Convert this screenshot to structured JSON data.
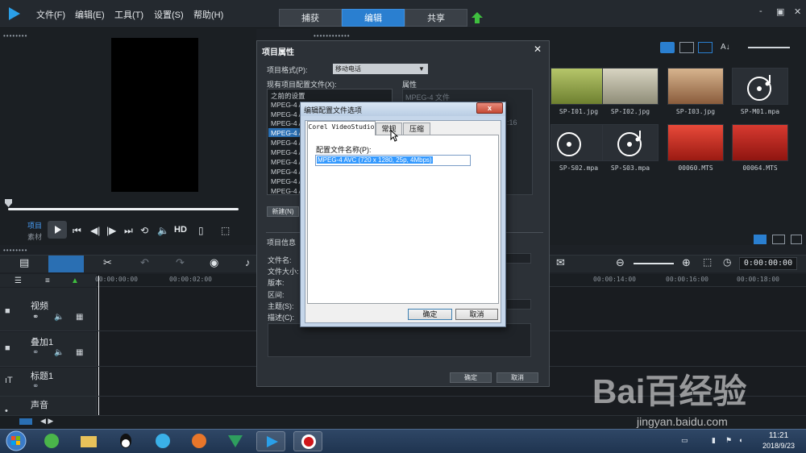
{
  "menu": {
    "file": "文件(F)",
    "edit": "编辑(E)",
    "tools": "工具(T)",
    "settings": "设置(S)",
    "help": "帮助(H)"
  },
  "mode_tabs": {
    "capture": "捕获",
    "edit": "编辑",
    "share": "共享"
  },
  "window_controls": {
    "minimize": "-",
    "restore": "▣",
    "close": "✕"
  },
  "preview": {
    "mode_project": "项目",
    "mode_clip": "素材",
    "hd": "HD"
  },
  "library": {
    "thumbnails": [
      {
        "label": "SP-I01.jpg"
      },
      {
        "label": "SP-I02.jpg"
      },
      {
        "label": "SP-I03.jpg"
      },
      {
        "label": "SP-M01.mpa"
      },
      {
        "label": "SP-S02.mpa"
      },
      {
        "label": "SP-S03.mpa"
      },
      {
        "label": "00060.MTS"
      },
      {
        "label": "00064.MTS"
      }
    ]
  },
  "timeline": {
    "timecode": "0:00:00:00",
    "ruler": [
      "00:00:00:00",
      "00:00:02:00",
      "00:00:14:00",
      "00:00:16:00",
      "00:00:18:00"
    ],
    "tracks": [
      {
        "name": "视频"
      },
      {
        "name": "叠加1"
      },
      {
        "name": "标题1"
      },
      {
        "name": "声音"
      }
    ]
  },
  "project_props": {
    "title": "项目属性",
    "format_label": "项目格式(P):",
    "format_value": "移动电话",
    "profiles_label": "现有项目配置文件(X):",
    "properties_label": "属性",
    "properties_value": "MPEG-4 文件",
    "properties_partial": ":16",
    "profiles": [
      "之前的设置",
      "MPEG-4 A",
      "MPEG-4 A",
      "MPEG-4 A",
      "MPEG-4 A",
      "MPEG-4 A",
      "MPEG-4 A",
      "MPEG-4 A",
      "MPEG-4 A",
      "MPEG-4 A",
      "MPEG-4 A"
    ],
    "new_button": "新建(N)",
    "info_label": "项目信息",
    "filename_label": "文件名:",
    "filesize_label": "文件大小:",
    "version_label": "版本:",
    "duration_label": "区间:",
    "subject_label": "主题(S):",
    "desc_label": "描述(C):",
    "ok": "确定",
    "cancel": "取消"
  },
  "win_dialog": {
    "title": "编辑配置文件选项",
    "close": "x",
    "tabs": [
      "Corel VideoStudio",
      "常规",
      "压缩"
    ],
    "name_label": "配置文件名称(P):",
    "name_value": "MPEG-4 AVC (720 x 1280, 25p, 4Mbps)",
    "ok": "确定",
    "cancel": "取消"
  },
  "taskbar": {
    "time": "11:21",
    "date": "2018/9/23"
  },
  "watermark": {
    "brand": "Bai百经验",
    "url": "jingyan.baidu.com"
  },
  "colors": {
    "accent": "#2a7fd0",
    "background": "#1d2126"
  }
}
